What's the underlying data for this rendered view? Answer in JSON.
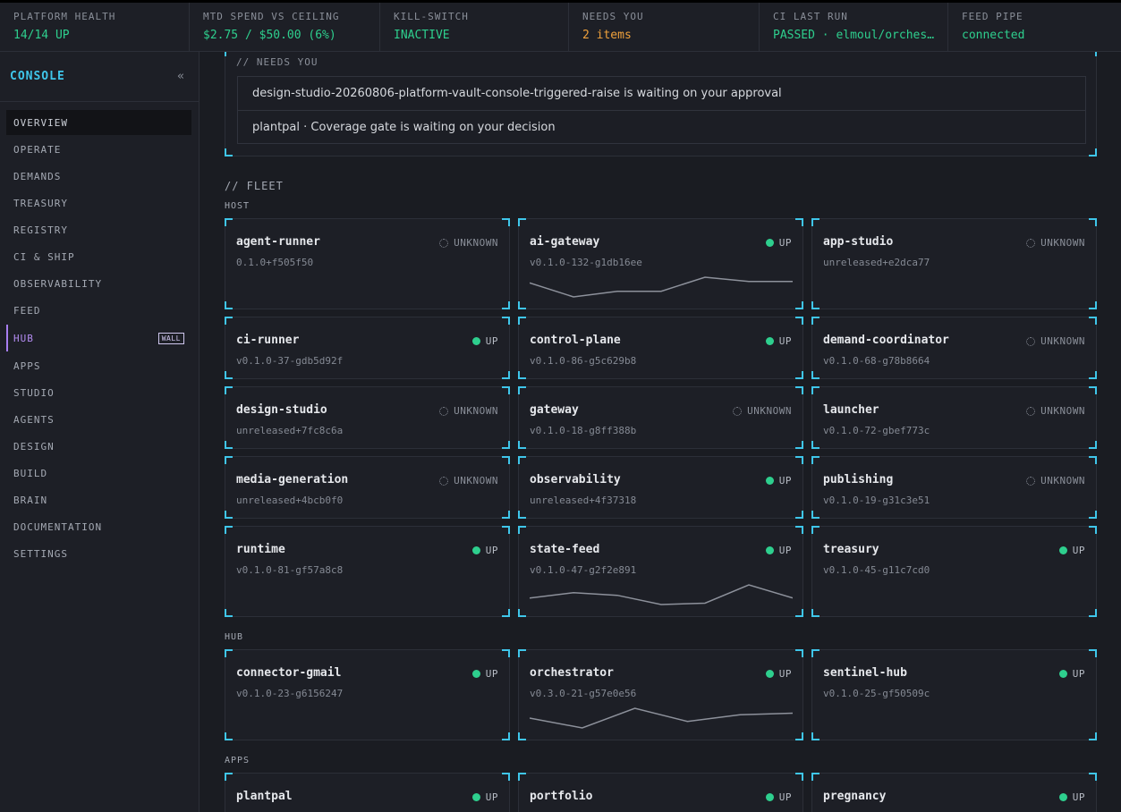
{
  "status_bar": [
    {
      "label": "PLATFORM HEALTH",
      "value": "14/14 UP",
      "color": "#2ecf8e"
    },
    {
      "label": "MTD SPEND VS CEILING",
      "value": "$2.75 / $50.00 (6%)",
      "color": "#2ecf8e"
    },
    {
      "label": "KILL-SWITCH",
      "value": "INACTIVE",
      "color": "#2ecf8e"
    },
    {
      "label": "NEEDS YOU",
      "value": "2 items",
      "color": "#f0a23c"
    },
    {
      "label": "CI LAST RUN",
      "value": "PASSED · elmoul/orchestrator",
      "color": "#2ecf8e"
    },
    {
      "label": "FEED PIPE",
      "value": "connected",
      "color": "#2ecf8e"
    }
  ],
  "sidebar": {
    "brand": "CONSOLE",
    "collapse_glyph": "«",
    "items": [
      {
        "label": "OVERVIEW",
        "active": true
      },
      {
        "label": "OPERATE"
      },
      {
        "label": "DEMANDS"
      },
      {
        "label": "TREASURY"
      },
      {
        "label": "REGISTRY"
      },
      {
        "label": "CI & SHIP"
      },
      {
        "label": "OBSERVABILITY"
      },
      {
        "label": "FEED"
      },
      {
        "label": "HUB",
        "badge": "WALL"
      },
      {
        "label": "APPS"
      },
      {
        "label": "STUDIO"
      },
      {
        "label": "AGENTS"
      },
      {
        "label": "DESIGN"
      },
      {
        "label": "BUILD"
      },
      {
        "label": "BRAIN"
      },
      {
        "label": "DOCUMENTATION"
      },
      {
        "label": "SETTINGS"
      }
    ]
  },
  "needs_you": {
    "title": "// NEEDS YOU",
    "items": [
      "design-studio-20260806-platform-vault-console-triggered-raise is waiting on your approval",
      "plantpal · Coverage gate is waiting on your decision"
    ]
  },
  "fleet": {
    "title": "// FLEET",
    "groups": [
      {
        "label": "HOST",
        "services": [
          {
            "name": "agent-runner",
            "status": "UNKNOWN",
            "version": "0.1.0+f505f50"
          },
          {
            "name": "ai-gateway",
            "status": "UP",
            "version": "v0.1.0-132-g1db16ee",
            "sparkline": [
              5,
              0,
              2,
              2,
              7,
              5.5,
              5.5
            ]
          },
          {
            "name": "app-studio",
            "status": "UNKNOWN",
            "version": "unreleased+e2dca77"
          },
          {
            "name": "ci-runner",
            "status": "UP",
            "version": "v0.1.0-37-gdb5d92f"
          },
          {
            "name": "control-plane",
            "status": "UP",
            "version": "v0.1.0-86-g5c629b8"
          },
          {
            "name": "demand-coordinator",
            "status": "UNKNOWN",
            "version": "v0.1.0-68-g78b8664"
          },
          {
            "name": "design-studio",
            "status": "UNKNOWN",
            "version": "unreleased+7fc8c6a"
          },
          {
            "name": "gateway",
            "status": "UNKNOWN",
            "version": "v0.1.0-18-g8ff388b"
          },
          {
            "name": "launcher",
            "status": "UNKNOWN",
            "version": "v0.1.0-72-gbef773c"
          },
          {
            "name": "media-generation",
            "status": "UNKNOWN",
            "version": "unreleased+4bcb0f0"
          },
          {
            "name": "observability",
            "status": "UP",
            "version": "unreleased+4f37318"
          },
          {
            "name": "publishing",
            "status": "UNKNOWN",
            "version": "v0.1.0-19-g31c3e51"
          },
          {
            "name": "runtime",
            "status": "UP",
            "version": "v0.1.0-81-gf57a8c8"
          },
          {
            "name": "state-feed",
            "status": "UP",
            "version": "v0.1.0-47-g2f2e891",
            "sparkline": [
              3,
              5,
              4,
              0.5,
              1,
              8,
              3
            ]
          },
          {
            "name": "treasury",
            "status": "UP",
            "version": "v0.1.0-45-g11c7cd0"
          }
        ]
      },
      {
        "label": "HUB",
        "services": [
          {
            "name": "connector-gmail",
            "status": "UP",
            "version": "v0.1.0-23-g6156247"
          },
          {
            "name": "orchestrator",
            "status": "UP",
            "version": "v0.3.0-21-g57e0e56",
            "sparkline": [
              3,
              0,
              6,
              2,
              4,
              4.5
            ]
          },
          {
            "name": "sentinel-hub",
            "status": "UP",
            "version": "v0.1.0-25-gf50509c"
          }
        ]
      },
      {
        "label": "APPS",
        "services": [
          {
            "name": "plantpal",
            "status": "UP",
            "version": ""
          },
          {
            "name": "portfolio",
            "status": "UP",
            "version": ""
          },
          {
            "name": "pregnancy",
            "status": "UP",
            "version": ""
          }
        ]
      }
    ]
  },
  "colors": {
    "accent": "#3fc6ea",
    "up": "#2ecf8e",
    "warn": "#f0a23c",
    "hub_nav": "#b48cf2"
  }
}
